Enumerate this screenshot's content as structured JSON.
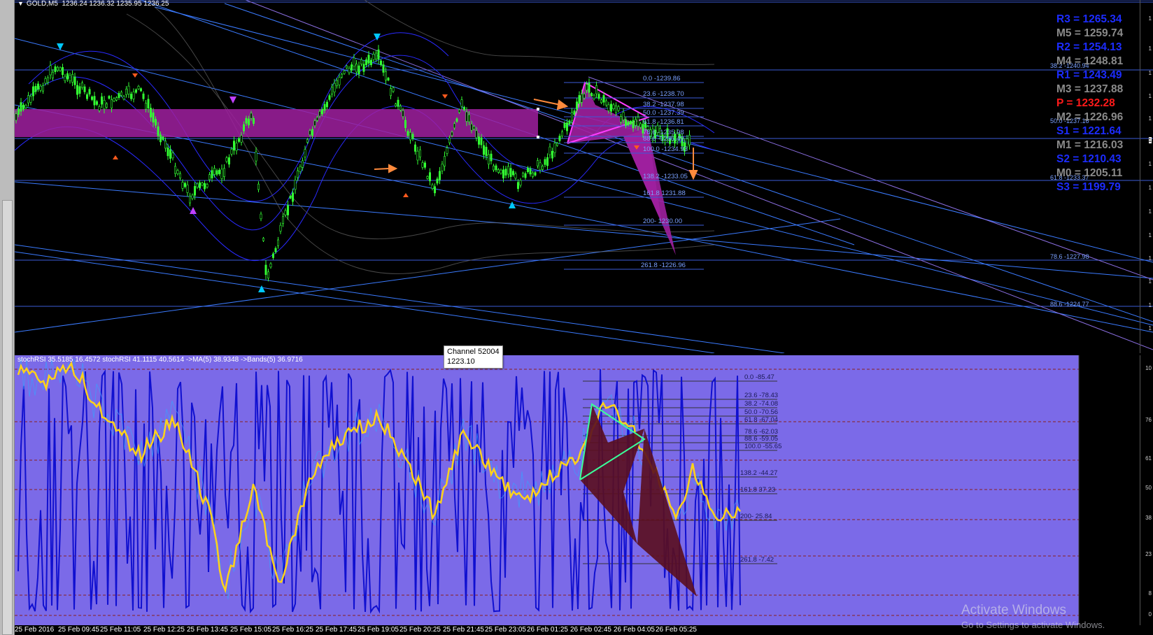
{
  "window": {
    "symbol_label": "GOLD,M5",
    "ohlc": "1236.24 1236.32 1235.95 1236.25"
  },
  "pivots": [
    {
      "label": "R3 = 1265.34",
      "color": "#1c2cff"
    },
    {
      "label": "M5 = 1259.74",
      "color": "#8a8a8a"
    },
    {
      "label": "R2 = 1254.13",
      "color": "#1c2cff"
    },
    {
      "label": "M4 = 1248.81",
      "color": "#8a8a8a"
    },
    {
      "label": "R1 = 1243.49",
      "color": "#1c2cff"
    },
    {
      "label": "M3 = 1237.88",
      "color": "#8a8a8a"
    },
    {
      "label": "P  = 1232.28",
      "color": "#ff1a1a"
    },
    {
      "label": "M2 = 1226.96",
      "color": "#8a8a8a"
    },
    {
      "label": "S1 = 1221.64",
      "color": "#1c2cff"
    },
    {
      "label": "M1 = 1216.03",
      "color": "#8a8a8a"
    },
    {
      "label": "S2 = 1210.43",
      "color": "#1c2cff"
    },
    {
      "label": "M0 = 1205.11",
      "color": "#8a8a8a"
    },
    {
      "label": "S3 = 1199.79",
      "color": "#1c2cff"
    }
  ],
  "main_fib_levels": [
    "0.0 -1239.86",
    "23.6 -1238.70",
    "38.2 -1237.98",
    "50.0 -1237.39",
    "61.8 -1236.81",
    "78.6 -1235.98",
    "88.6 -1235.49",
    "100.0 -1234.93",
    "138.2 -1233.05",
    "161.8 1231.88",
    "200- 1230.00",
    "261.8 -1226.96"
  ],
  "right_labels": [
    "38.2 -1240.94",
    "50.0 -1237.16",
    "61.8 -1233.37",
    "78.6 -1227.98",
    "88.6 -1224.77"
  ],
  "indicator": {
    "title": "stochRSI 35.5185 16.4572  stochRSI 41.1115 40.5614  ->MA(5) 38.9348  ->Bands(5) 36.9716",
    "fib_levels": [
      "0.0 -85.47",
      "23.6 -78.43",
      "38.2 -74.08",
      "50.0 -70.56",
      "61.8 -67.04",
      "78.6 -62.03",
      "88.6 -59.05",
      "100.0 -55.65",
      "138.2  -44.27",
      "161.8 37.23",
      "200- 25.84",
      "261.8 -7.42"
    ]
  },
  "tooltip": {
    "line1": "Channel 52004",
    "line2": "1223.10"
  },
  "time_axis": [
    "25 Feb 2016",
    "25 Feb 09:45",
    "25 Feb 11:05",
    "25 Feb 12:25",
    "25 Feb 13:45",
    "25 Feb 15:05",
    "25 Feb 16:25",
    "25 Feb 17:45",
    "25 Feb 19:05",
    "25 Feb 20:25",
    "25 Feb 21:45",
    "25 Feb 23:05",
    "26 Feb 01:25",
    "26 Feb 02:45",
    "26 Feb 04:05",
    "26 Feb 05:25"
  ],
  "watermark": {
    "line1": "Activate Windows",
    "line2": "Go to Settings to activate Windows."
  },
  "colors": {
    "candles": "#33ff33",
    "zone": "#a020a0",
    "stoch_yellow": "#ffd21a",
    "stoch_blue": "#1010d0",
    "channel": "#4a7aff",
    "pane_bg": "#7b6ae8"
  }
}
